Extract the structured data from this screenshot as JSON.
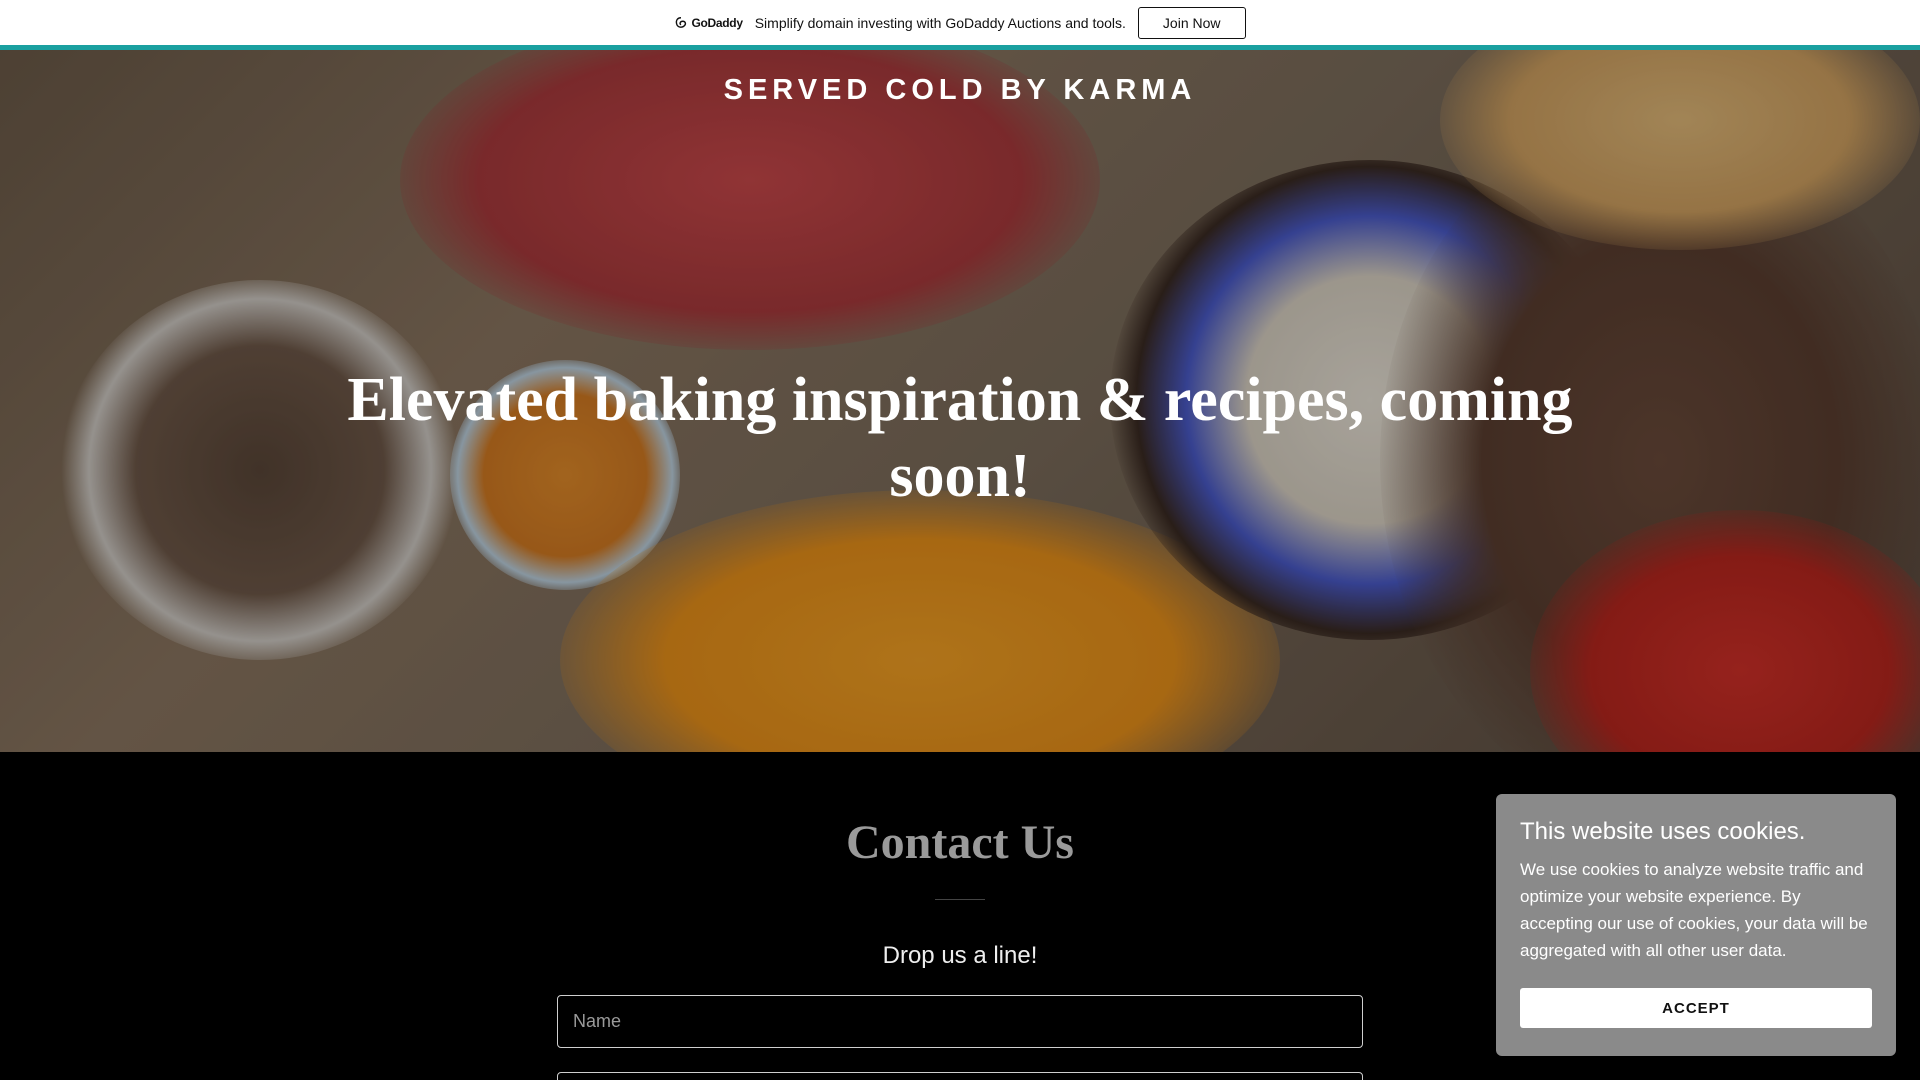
{
  "promo": {
    "logo_text": "GoDaddy",
    "message": "Simplify domain investing with GoDaddy Auctions and tools.",
    "join_label": "Join Now",
    "accent_color": "#1aa0a0"
  },
  "hero": {
    "brand": "SERVED COLD BY KARMA",
    "title": "Elevated baking inspiration & recipes, coming soon!"
  },
  "contact": {
    "title": "Contact Us",
    "subtitle": "Drop us a line!",
    "name_placeholder": "Name"
  },
  "cookie": {
    "title": "This website uses cookies.",
    "text": "We use cookies to analyze website traffic and optimize your website experience. By accepting our use of cookies, your data will be aggregated with all other user data.",
    "accept_label": "ACCEPT"
  }
}
